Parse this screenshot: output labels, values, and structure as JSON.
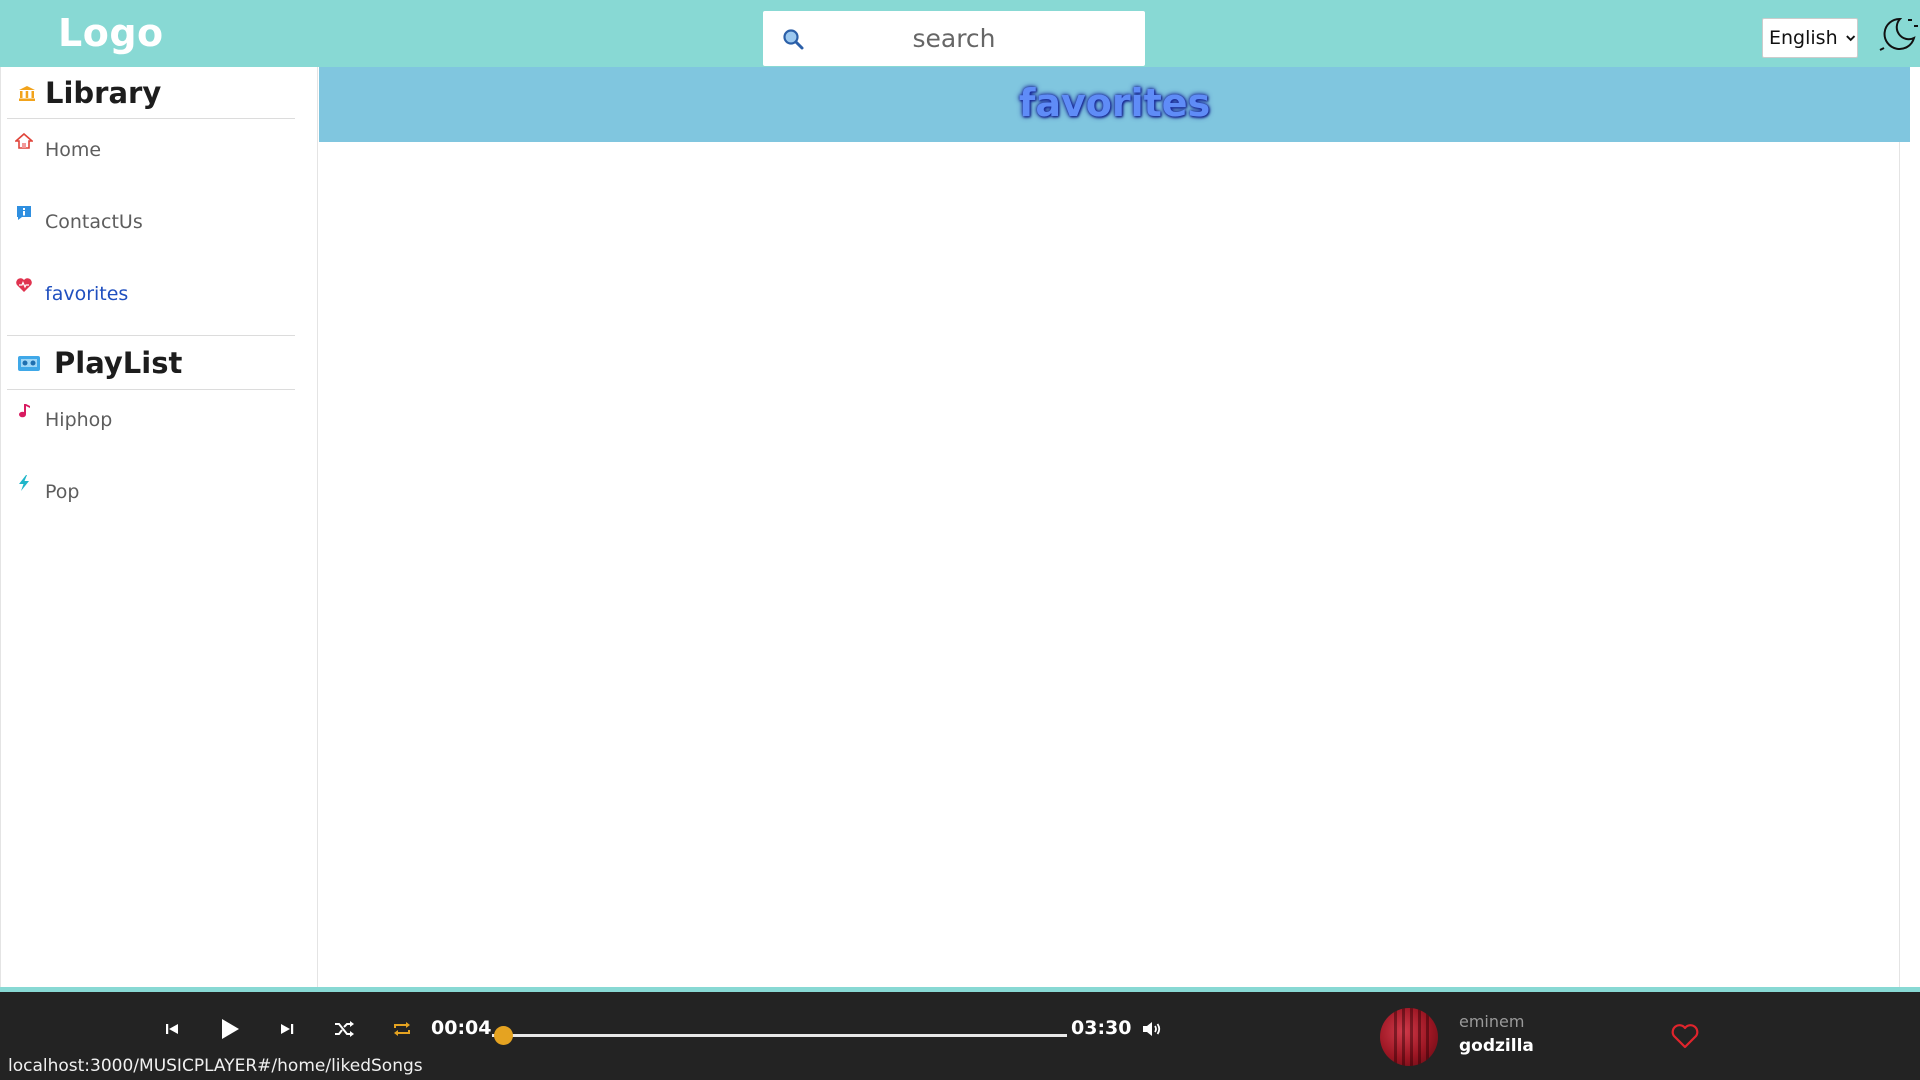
{
  "header": {
    "logo": "Logo",
    "search_placeholder": "search",
    "language": "English"
  },
  "sidebar": {
    "library_title": "Library",
    "library_items": [
      {
        "label": "Home",
        "icon": "home-icon"
      },
      {
        "label": "ContactUs",
        "icon": "info-icon"
      },
      {
        "label": "favorites",
        "icon": "heart-icon",
        "active": true
      }
    ],
    "playlist_title": "PlayList",
    "playlist_items": [
      {
        "label": "Hiphop",
        "icon": "music-note-icon"
      },
      {
        "label": "Pop",
        "icon": "lightning-icon"
      }
    ]
  },
  "main": {
    "title": "favorites"
  },
  "player": {
    "current_time": "00:04",
    "duration": "03:30",
    "progress_fraction": 0.019,
    "artist": "eminem",
    "song": "godzilla"
  },
  "status_bar": {
    "url": "localhost:3000/MUSICPLAYER#/home/likedSongs"
  },
  "colors": {
    "topbar": "#88d9d4",
    "main_header": "#80c6df",
    "player_bg": "#232323",
    "accent_thumb": "#e5a321",
    "active_link": "#1f4fbf"
  }
}
